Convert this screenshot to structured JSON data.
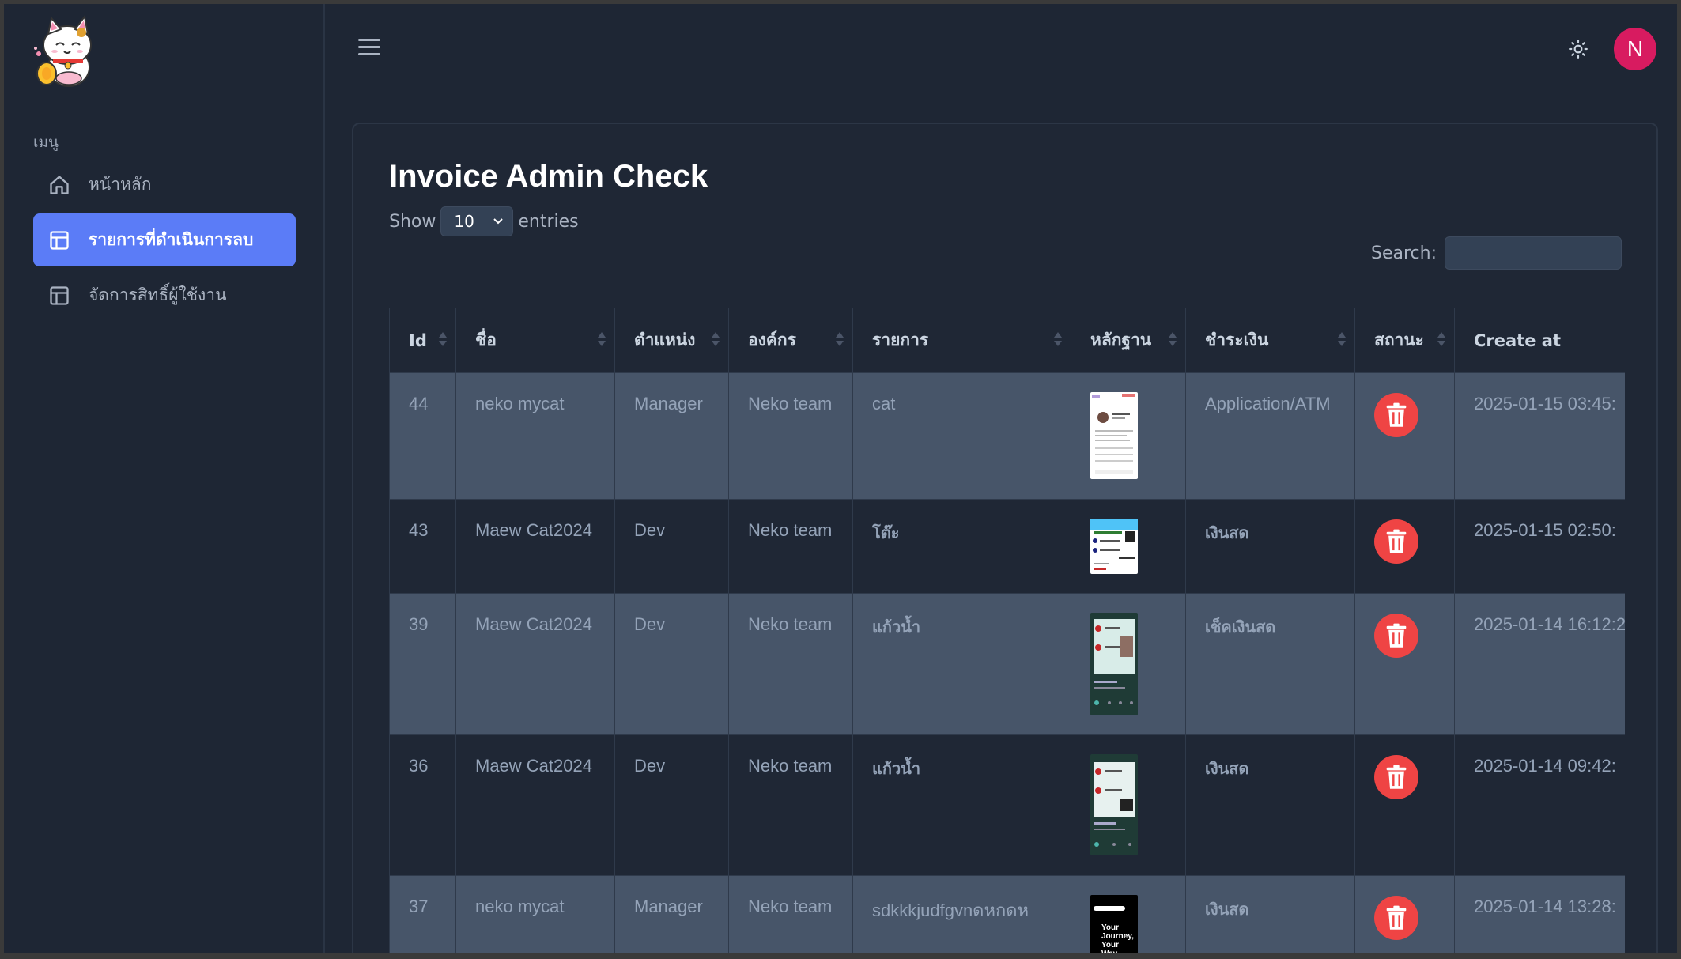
{
  "sidebar": {
    "menu_heading": "เมนู",
    "items": [
      {
        "label": "หน้าหลัก",
        "icon": "home-icon",
        "active": false
      },
      {
        "label": "รายการที่ดำเนินการลบ",
        "icon": "table-icon",
        "active": true
      },
      {
        "label": "จัดการสิทธิ์ผู้ใช้งาน",
        "icon": "table-icon",
        "active": false
      }
    ]
  },
  "header": {
    "avatar_initial": "N",
    "avatar_color": "#d81b60"
  },
  "main": {
    "title": "Invoice Admin Check",
    "show_label": "Show",
    "entries_value": "10",
    "entries_label": "entries",
    "search_label": "Search:",
    "search_value": "",
    "columns": [
      "Id",
      "ชื่อ",
      "ตำแหน่ง",
      "องค์กร",
      "รายการ",
      "หลักฐาน",
      "ชำระเงิน",
      "สถานะ",
      "Create at"
    ],
    "rows": [
      {
        "id": "44",
        "name": "neko mycat",
        "position": "Manager",
        "org": "Neko team",
        "item": "cat",
        "payment": "Application/ATM",
        "created": "2025-01-15 03:45:"
      },
      {
        "id": "43",
        "name": "Maew Cat2024",
        "position": "Dev",
        "org": "Neko team",
        "item": "โต๊ะ",
        "payment": "เงินสด",
        "created": "2025-01-15 02:50:"
      },
      {
        "id": "39",
        "name": "Maew Cat2024",
        "position": "Dev",
        "org": "Neko team",
        "item": "แก้วน้ำ",
        "payment": "เช็คเงินสด",
        "created": "2025-01-14 16:12:2"
      },
      {
        "id": "36",
        "name": "Maew Cat2024",
        "position": "Dev",
        "org": "Neko team",
        "item": "แก้วน้ำ",
        "payment": "เงินสด",
        "created": "2025-01-14 09:42:"
      },
      {
        "id": "37",
        "name": "neko mycat",
        "position": "Manager",
        "org": "Neko team",
        "item": "sdkkkjudfgvnดหกดห",
        "payment": "เงินสด",
        "created": "2025-01-14 13:28:"
      }
    ],
    "thumb_text": "Your Journey, Your Way."
  },
  "colors": {
    "accent": "#5b7cf7",
    "delete": "#ef4444",
    "background": "#1e2634",
    "row_odd": "#475569"
  }
}
